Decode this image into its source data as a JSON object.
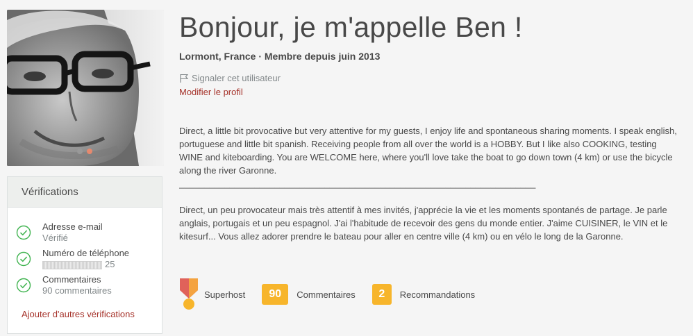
{
  "profile": {
    "title": "Bonjour, je m'appelle Ben !",
    "meta": "Lormont, France · Membre depuis juin 2013",
    "report_label": "Signaler cet utilisateur",
    "edit_label": "Modifier le profil",
    "about_en": "Direct, a little bit provocative but very attentive for my guests, I enjoy life and spontaneous sharing moments. I speak english, portuguese and little bit spanish. Receiving people from all over the world is a HOBBY. But I like also COOKING, testing WINE and kiteboarding. You are WELCOME here, where you'll love take the boat to go down town (4 km) or use the bicycle along the river Garonne.",
    "separator": "_______________________________________________________________________",
    "about_fr": "Direct, un peu provocateur mais très attentif à mes invités, j'apprécie la vie et les moments spontanés de partage. Je parle anglais, portugais et un peu espagnol. J'ai l'habitude de recevoir des gens du monde entier. J'aime CUISINER, le VIN et le kitesurf... Vous allez adorer prendre le bateau pour aller en centre ville (4 km) ou en vélo le long de la Garonne."
  },
  "photo": {
    "carousel_count": 2,
    "carousel_active_index": 1
  },
  "verifications": {
    "header": "Vérifications",
    "items": [
      {
        "title": "Adresse e-mail",
        "sub": "Vérifié"
      },
      {
        "title": "Numéro de téléphone",
        "sub": "25"
      },
      {
        "title": "Commentaires",
        "sub": "90 commentaires"
      }
    ],
    "add_link": "Ajouter d'autres vérifications"
  },
  "badges": {
    "superhost_label": "Superhost",
    "reviews_count": "90",
    "reviews_label": "Commentaires",
    "recommendations_count": "2",
    "recommendations_label": "Recommandations"
  },
  "colors": {
    "accent_link": "#a6332b",
    "badge_yellow": "#f7b52b",
    "check_green": "#3fb34f"
  }
}
